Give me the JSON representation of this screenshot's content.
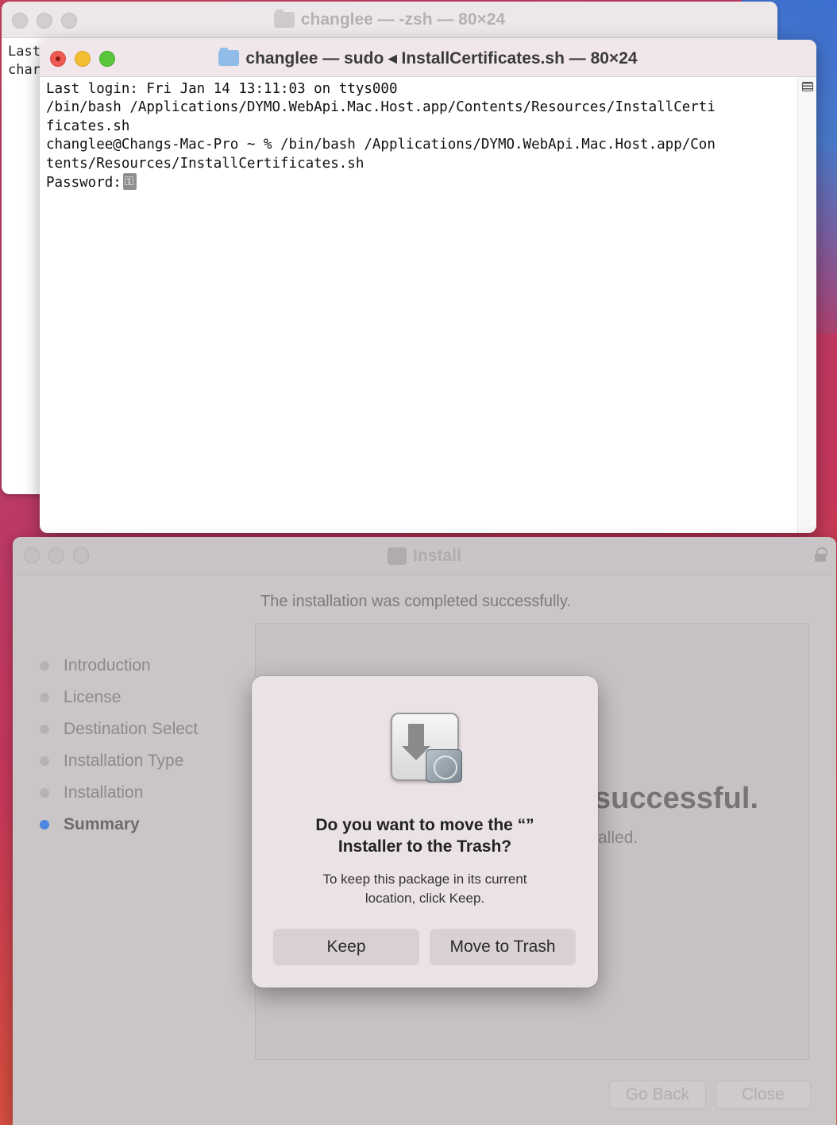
{
  "terminal_back": {
    "title": "changlee — -zsh — 80×24",
    "peek_lines": "Last\nchar"
  },
  "terminal_front": {
    "title": "changlee — sudo ◂ InstallCertificates.sh — 80×24",
    "lines": [
      "Last login: Fri Jan 14 13:11:03 on ttys000",
      "/bin/bash /Applications/DYMO.WebApi.Mac.Host.app/Contents/Resources/InstallCerti",
      "ficates.sh",
      "changlee@Changs-Mac-Pro ~ % /bin/bash /Applications/DYMO.WebApi.Mac.Host.app/Con",
      "tents/Resources/InstallCertificates.sh"
    ],
    "prompt": "Password:"
  },
  "installer": {
    "title": "Install",
    "heading": "The installation was completed successfully.",
    "steps": [
      {
        "label": "Introduction"
      },
      {
        "label": "License"
      },
      {
        "label": "Destination Select"
      },
      {
        "label": "Installation Type"
      },
      {
        "label": "Installation"
      },
      {
        "label": "Summary"
      }
    ],
    "result_title": "successful.",
    "result_sub": "alled.",
    "go_back_label": "Go Back",
    "close_label": "Close"
  },
  "dialog": {
    "title_line1": "Do you want to move the “”",
    "title_line2": "Installer to the Trash?",
    "message_line1": "To keep this package in its current",
    "message_line2": "location, click Keep.",
    "keep_label": "Keep",
    "trash_label": "Move to Trash"
  }
}
